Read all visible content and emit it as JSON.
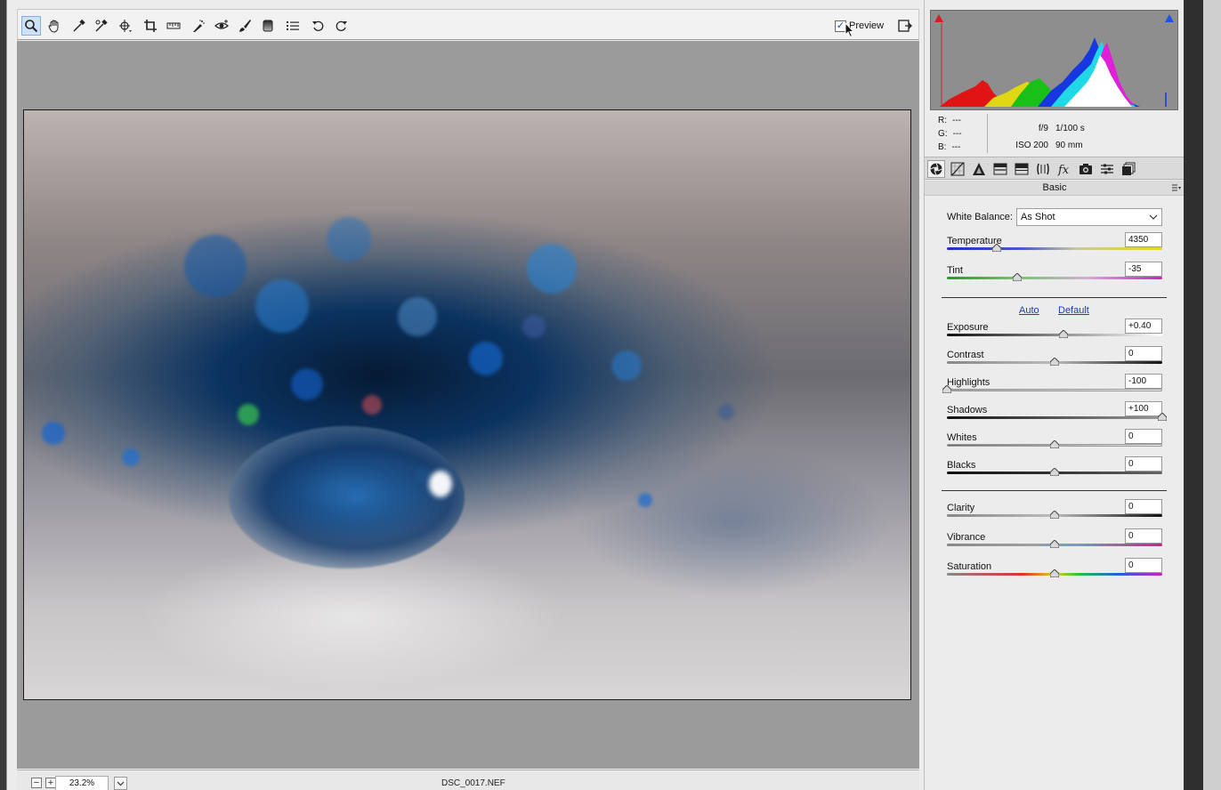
{
  "toolbar": {
    "tools": [
      {
        "name": "zoom-tool-icon",
        "active": true
      },
      {
        "name": "hand-tool-icon"
      },
      {
        "name": "white-balance-tool-icon"
      },
      {
        "name": "color-sampler-tool-icon"
      },
      {
        "name": "targeted-adjustment-tool-icon"
      },
      {
        "name": "crop-tool-icon"
      },
      {
        "name": "straighten-tool-icon"
      },
      {
        "name": "spot-removal-tool-icon"
      },
      {
        "name": "red-eye-removal-icon"
      },
      {
        "name": "adjustment-brush-icon"
      },
      {
        "name": "graduated-filter-icon"
      },
      {
        "name": "list-icon"
      },
      {
        "name": "rotate-left-icon"
      },
      {
        "name": "rotate-right-icon"
      }
    ],
    "preview_label": "Preview",
    "preview_checked": true
  },
  "status_bar": {
    "zoom_out": "−",
    "zoom_in": "+",
    "zoom_value": "23.2%",
    "filename": "DSC_0017.NEF"
  },
  "histogram": {
    "rgb": [
      {
        "label": "R:",
        "value": "---"
      },
      {
        "label": "G:",
        "value": "---"
      },
      {
        "label": "B:",
        "value": "---"
      }
    ],
    "aperture": "f/9",
    "shutter": "1/100 s",
    "iso": "ISO 200",
    "focal_length": "90 mm"
  },
  "panel": {
    "title": "Basic",
    "white_balance_label": "White Balance:",
    "white_balance_value": "As Shot",
    "auto_label": "Auto",
    "default_label": "Default",
    "sliders": {
      "temperature": {
        "label": "Temperature",
        "value": "4350",
        "position": 0.23
      },
      "tint": {
        "label": "Tint",
        "value": "-35",
        "position": 0.325
      },
      "exposure": {
        "label": "Exposure",
        "value": "+0.40",
        "position": 0.54
      },
      "contrast": {
        "label": "Contrast",
        "value": "0",
        "position": 0.5
      },
      "highlights": {
        "label": "Highlights",
        "value": "-100",
        "position": 0.0
      },
      "shadows": {
        "label": "Shadows",
        "value": "+100",
        "position": 1.0
      },
      "whites": {
        "label": "Whites",
        "value": "0",
        "position": 0.5
      },
      "blacks": {
        "label": "Blacks",
        "value": "0",
        "position": 0.5
      },
      "clarity": {
        "label": "Clarity",
        "value": "0",
        "position": 0.5
      },
      "vibrance": {
        "label": "Vibrance",
        "value": "0",
        "position": 0.5
      },
      "saturation": {
        "label": "Saturation",
        "value": "0",
        "position": 0.5
      }
    }
  },
  "colors": {
    "accent": "#1a3fa8",
    "link": "#1a3fa8",
    "active_tool_bg": "#cfe2f5"
  }
}
